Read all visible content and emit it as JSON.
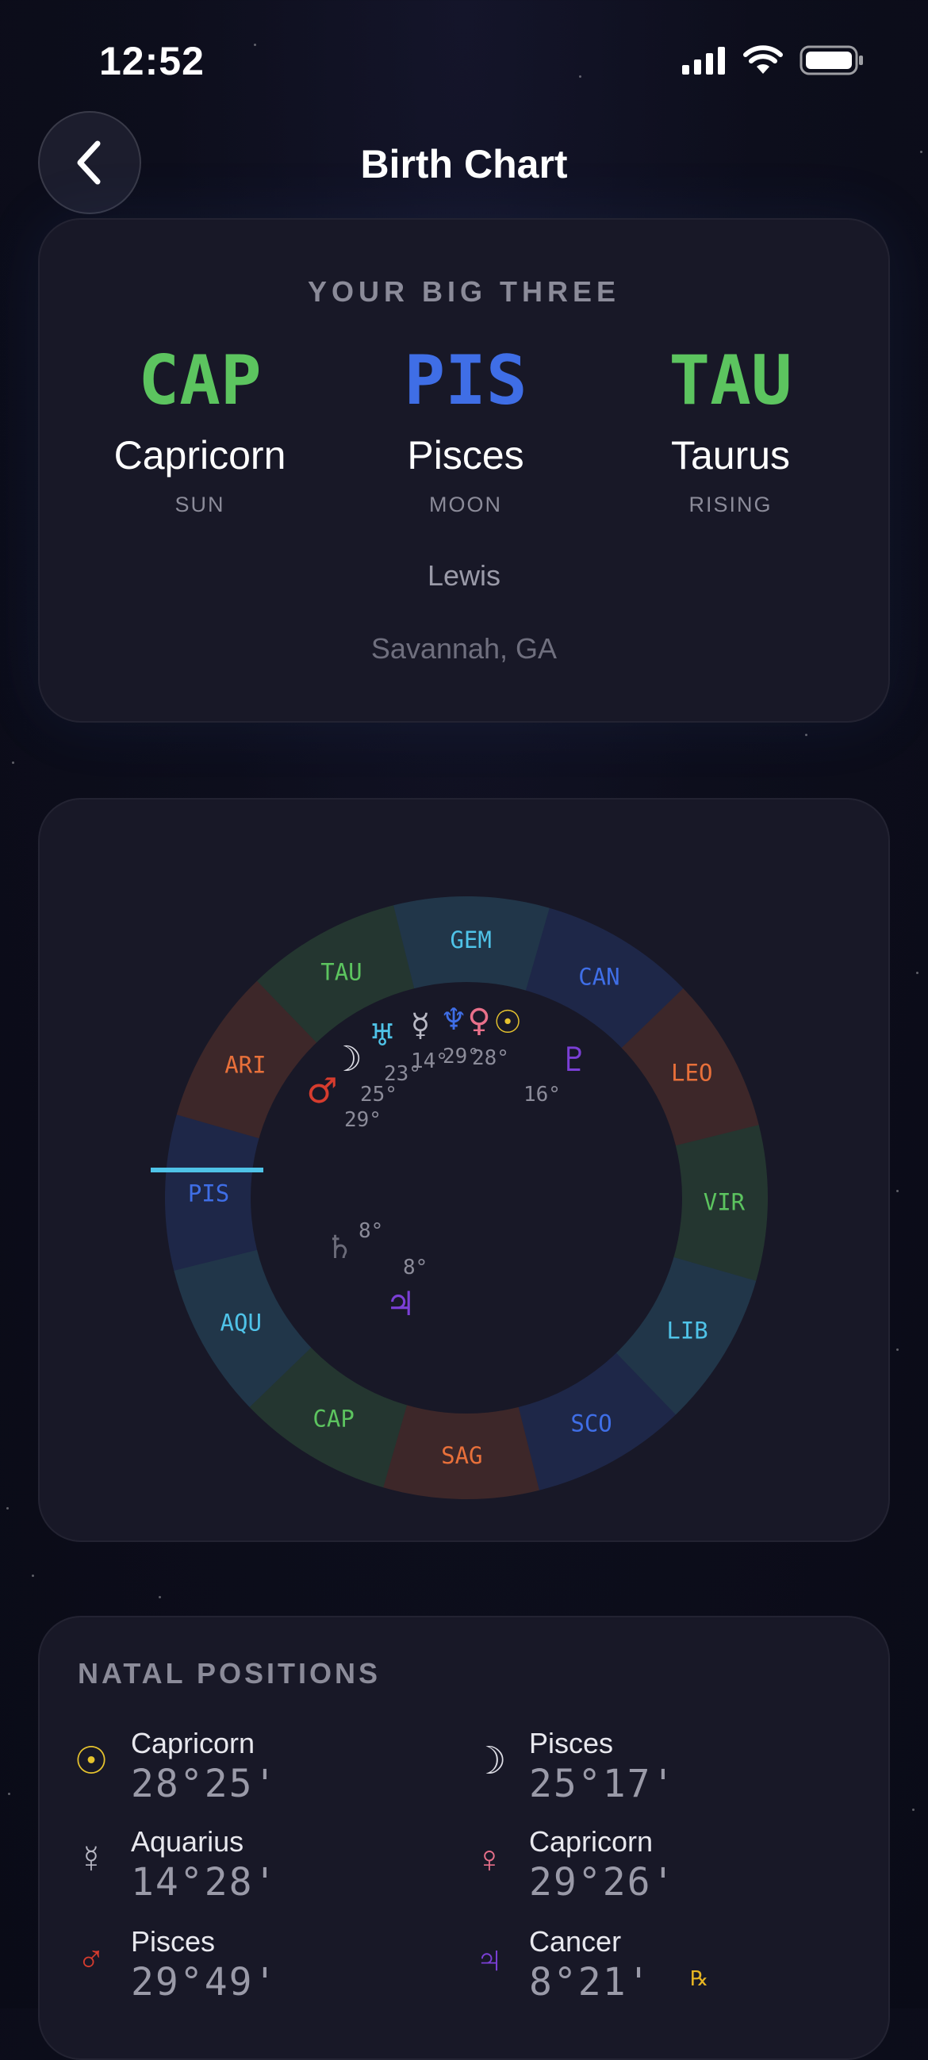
{
  "status_bar": {
    "time": "12:52"
  },
  "header": {
    "title": "Birth Chart"
  },
  "big_three": {
    "heading": "YOUR BIG THREE",
    "items": [
      {
        "abbr": "CAP",
        "name": "Capricorn",
        "role": "SUN",
        "color": "#5cc45f"
      },
      {
        "abbr": "PIS",
        "name": "Pisces",
        "role": "MOON",
        "color": "#3f6ee6"
      },
      {
        "abbr": "TAU",
        "name": "Taurus",
        "role": "RISING",
        "color": "#5cc45f"
      }
    ],
    "person": "Lewis",
    "place": "Savannah, GA"
  },
  "wheel": {
    "signs": [
      {
        "abbr": "ARI",
        "color": "#e8703a"
      },
      {
        "abbr": "TAU",
        "color": "#5cc45f"
      },
      {
        "abbr": "GEM",
        "color": "#4fc3e8"
      },
      {
        "abbr": "CAN",
        "color": "#3f6ee6"
      },
      {
        "abbr": "LEO",
        "color": "#e8703a"
      },
      {
        "abbr": "VIR",
        "color": "#5cc45f"
      },
      {
        "abbr": "LIB",
        "color": "#4fc3e8"
      },
      {
        "abbr": "SCO",
        "color": "#3f6ee6"
      },
      {
        "abbr": "SAG",
        "color": "#e8703a"
      },
      {
        "abbr": "CAP",
        "color": "#5cc45f"
      },
      {
        "abbr": "AQU",
        "color": "#4fc3e8"
      },
      {
        "abbr": "PIS",
        "color": "#3f6ee6"
      }
    ],
    "planet_glyphs": [
      {
        "name": "sun",
        "glyph": "☉",
        "color": "#e6c32e"
      },
      {
        "name": "venus",
        "glyph": "♀",
        "color": "#e8708a"
      },
      {
        "name": "neptune",
        "glyph": "♆",
        "color": "#3f6ee6"
      },
      {
        "name": "mercury",
        "glyph": "☿",
        "color": "#b8b8c4"
      },
      {
        "name": "uranus",
        "glyph": "♅",
        "color": "#4fc3e8"
      },
      {
        "name": "moon",
        "glyph": "☽",
        "color": "#dcdce4"
      },
      {
        "name": "mars",
        "glyph": "♂",
        "color": "#d63c2e"
      },
      {
        "name": "pluto",
        "glyph": "♇",
        "color": "#7b3fd6"
      },
      {
        "name": "saturn",
        "glyph": "♄",
        "color": "#6a6a78"
      },
      {
        "name": "jupiter",
        "glyph": "♃",
        "color": "#7b3fd6"
      }
    ],
    "degree_labels": [
      "29°",
      "28°",
      "14°",
      "23°",
      "25°",
      "29°",
      "16°",
      "8°",
      "8°"
    ],
    "ascendant_color": "#4fc3e8"
  },
  "positions": {
    "heading": "NATAL POSITIONS",
    "items": [
      {
        "glyph": "☉",
        "color": "#e6c32e",
        "sign": "Capricorn",
        "degree": "28°25'",
        "retro": ""
      },
      {
        "glyph": "☽",
        "color": "#dcdce4",
        "sign": "Pisces",
        "degree": "25°17'",
        "retro": ""
      },
      {
        "glyph": "☿",
        "color": "#b8b8c4",
        "sign": "Aquarius",
        "degree": "14°28'",
        "retro": ""
      },
      {
        "glyph": "♀",
        "color": "#e8708a",
        "sign": "Capricorn",
        "degree": "29°26'",
        "retro": ""
      },
      {
        "glyph": "♂",
        "color": "#d63c2e",
        "sign": "Pisces",
        "degree": "29°49'",
        "retro": ""
      },
      {
        "glyph": "♃",
        "color": "#7b3fd6",
        "sign": "Cancer",
        "degree": "8°21'",
        "retro": "℞"
      }
    ]
  }
}
